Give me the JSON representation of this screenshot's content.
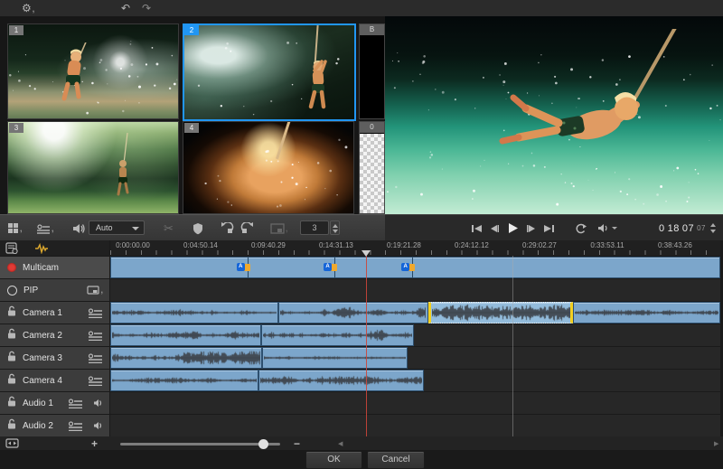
{
  "glyphs": {
    "gear": "⚙",
    "undo": "↶",
    "redo": "↷",
    "scissors": "✂",
    "plus": "+",
    "minus": "−",
    "comma": ",",
    "left_arrow": "◀",
    "right_arrow": "▶"
  },
  "colors": {
    "accent_blue": "#2196f3",
    "clip_blue": "#7ca6cb",
    "selected_yellow": "#f3d021",
    "record_red": "#e23b35",
    "badge_blue": "#1565d8",
    "badge_orange": "#f0a92e",
    "audio_icon_yellow": "#d9a62e"
  },
  "camera_bank": {
    "cameras": [
      {
        "id": "1",
        "selected": false
      },
      {
        "id": "2",
        "selected": true
      },
      {
        "id": "3",
        "selected": false
      },
      {
        "id": "4",
        "selected": false
      }
    ],
    "blank_label": "B",
    "zero_label": "0"
  },
  "toolbar": {
    "audio_mode": "Auto",
    "split_frames": "3"
  },
  "transport": {
    "time": {
      "h": "0",
      "m": "18",
      "s": "07",
      "f": "07"
    }
  },
  "timeline": {
    "ruler": [
      "0:00:00.00",
      "0:04:50.14",
      "0:09:40.29",
      "0:14:31.13",
      "0:19:21.28",
      "0:24:12.12",
      "0:29:02.27",
      "0:33:53.11",
      "0:38:43.26"
    ],
    "tracks": [
      {
        "label": "Multicam"
      },
      {
        "label": "PIP"
      },
      {
        "label": "Camera 1"
      },
      {
        "label": "Camera 2"
      },
      {
        "label": "Camera 3"
      },
      {
        "label": "Camera 4"
      },
      {
        "label": "Audio 1"
      },
      {
        "label": "Audio 2"
      }
    ],
    "multicam_marker_label": "A",
    "lanes": {
      "multicam": {
        "cuts_pct": [
          22.4,
          36.7,
          49.5
        ]
      },
      "camera1": {
        "clips": [
          {
            "s": 0,
            "e": 27.6,
            "amp": 0.45,
            "seed": 11
          },
          {
            "s": 27.6,
            "e": 52.1,
            "amp": 0.8,
            "seed": 22
          },
          {
            "s": 52.1,
            "e": 75.9,
            "amp": 0.95,
            "seed": 33,
            "selected": true
          },
          {
            "s": 75.9,
            "e": 100,
            "amp": 0.35,
            "seed": 44
          }
        ]
      },
      "camera2": {
        "clips": [
          {
            "s": 0,
            "e": 24.7,
            "amp": 0.72,
            "seed": 55
          },
          {
            "s": 24.7,
            "e": 49.8,
            "amp": 0.9,
            "seed": 66
          }
        ]
      },
      "camera3": {
        "clips": [
          {
            "s": 0,
            "e": 24.9,
            "amp": 0.96,
            "seed": 77
          },
          {
            "s": 24.9,
            "e": 48.7,
            "amp": 0.35,
            "seed": 88
          }
        ]
      },
      "camera4": {
        "clips": [
          {
            "s": 0,
            "e": 24.3,
            "amp": 0.35,
            "seed": 99
          },
          {
            "s": 24.3,
            "e": 51.4,
            "amp": 0.5,
            "seed": 111
          }
        ]
      },
      "audio1": {
        "clips": []
      },
      "audio2": {
        "clips": []
      }
    },
    "playhead_pct": 41.9,
    "marker_line_pct": 65.9
  },
  "footer": {
    "ok_label": "OK",
    "cancel_label": "Cancel"
  }
}
